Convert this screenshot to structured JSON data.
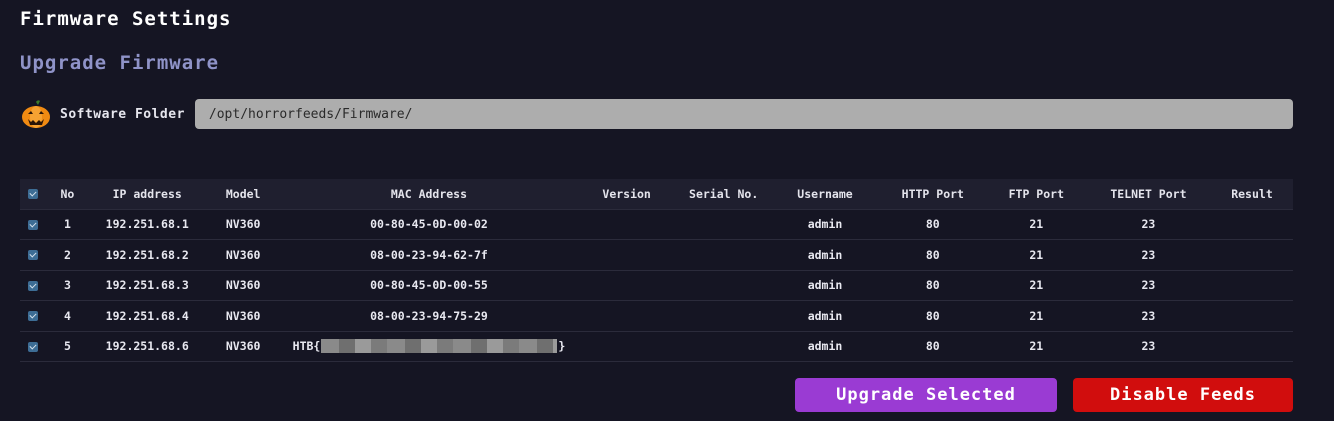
{
  "page": {
    "title": "Firmware Settings",
    "section_title": "Upgrade Firmware"
  },
  "folder": {
    "label": "Software Folder",
    "value": "/opt/horrorfeeds/Firmware/",
    "icon": "pumpkin-icon"
  },
  "table": {
    "headers": [
      "No",
      "IP address",
      "Model",
      "MAC Address",
      "Version",
      "Serial No.",
      "Username",
      "HTTP Port",
      "FTP Port",
      "TELNET Port",
      "Result"
    ],
    "rows": [
      {
        "no": "1",
        "ip": "192.251.68.1",
        "model": "NV360",
        "mac": "00-80-45-0D-00-02",
        "version": "",
        "serial": "",
        "username": "admin",
        "http": "80",
        "ftp": "21",
        "telnet": "23",
        "result": ""
      },
      {
        "no": "2",
        "ip": "192.251.68.2",
        "model": "NV360",
        "mac": "08-00-23-94-62-7f",
        "version": "",
        "serial": "",
        "username": "admin",
        "http": "80",
        "ftp": "21",
        "telnet": "23",
        "result": ""
      },
      {
        "no": "3",
        "ip": "192.251.68.3",
        "model": "NV360",
        "mac": "00-80-45-0D-00-55",
        "version": "",
        "serial": "",
        "username": "admin",
        "http": "80",
        "ftp": "21",
        "telnet": "23",
        "result": ""
      },
      {
        "no": "4",
        "ip": "192.251.68.4",
        "model": "NV360",
        "mac": "08-00-23-94-75-29",
        "version": "",
        "serial": "",
        "username": "admin",
        "http": "80",
        "ftp": "21",
        "telnet": "23",
        "result": ""
      },
      {
        "no": "5",
        "ip": "192.251.68.6",
        "model": "NV360",
        "mac_prefix": "HTB{",
        "mac_suffix": "}",
        "version": "",
        "serial": "",
        "username": "admin",
        "http": "80",
        "ftp": "21",
        "telnet": "23",
        "result": ""
      }
    ]
  },
  "buttons": {
    "upgrade_label": "Upgrade Selected",
    "disable_label": "Disable Feeds"
  },
  "colors": {
    "background": "#151523",
    "section_title": "#8f93c8",
    "upgrade_button": "#9a3bd3",
    "disable_button": "#d10d0d",
    "checkbox": "#3d6d95"
  }
}
